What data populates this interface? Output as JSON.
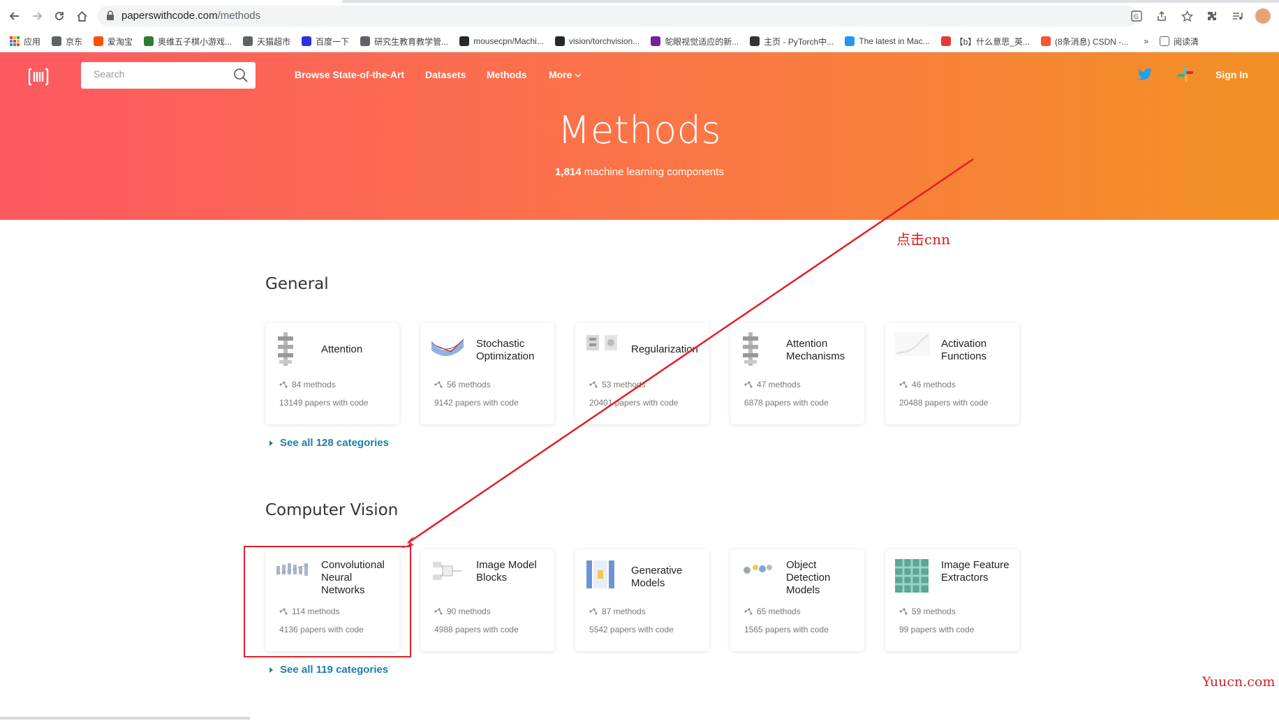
{
  "browser": {
    "url_host": "paperswithcode.com",
    "url_path": "/methods",
    "bookmarks": [
      {
        "label": "应用",
        "color": "#e8453c"
      },
      {
        "label": "京东",
        "color": "#5f6368"
      },
      {
        "label": "爱淘宝",
        "color": "#ff5000"
      },
      {
        "label": "奥维五子棋小游戏...",
        "color": "#2e7d32"
      },
      {
        "label": "天猫超市",
        "color": "#5f6368"
      },
      {
        "label": "百度一下",
        "color": "#2932e1"
      },
      {
        "label": "研究生教育教学管...",
        "color": "#5f6368"
      },
      {
        "label": "mousecpn/Machi...",
        "color": "#24292e"
      },
      {
        "label": "vision/torchvision...",
        "color": "#24292e"
      },
      {
        "label": "鸵眼视觉适应的新...",
        "color": "#7b1fa2"
      },
      {
        "label": "主页 - PyTorch中...",
        "color": "#333333"
      },
      {
        "label": "The latest in Mac...",
        "color": "#2196f3"
      },
      {
        "label": "【b】什么意思_英...",
        "color": "#e53935"
      },
      {
        "label": "(8条消息) CSDN -...",
        "color": "#fc5531"
      }
    ],
    "bookmarks_more": "»",
    "reading_list": "阅读清"
  },
  "header": {
    "search_placeholder": "Search",
    "nav": [
      "Browse State-of-the-Art",
      "Datasets",
      "Methods",
      "More"
    ],
    "sign_in": "Sign In"
  },
  "hero": {
    "title": "Methods",
    "count": "1,814",
    "subtitle": "machine learning components"
  },
  "general": {
    "title": "General",
    "cards": [
      {
        "name": "Attention",
        "methods": "84 methods",
        "papers": "13149 papers with code"
      },
      {
        "name": "Stochastic Optimization",
        "methods": "56 methods",
        "papers": "9142 papers with code"
      },
      {
        "name": "Regularization",
        "methods": "53 methods",
        "papers": "20401 papers with code"
      },
      {
        "name": "Attention Mechanisms",
        "methods": "47 methods",
        "papers": "6878 papers with code"
      },
      {
        "name": "Activation Functions",
        "methods": "46 methods",
        "papers": "20488 papers with code"
      }
    ],
    "see_all": "See all 128 categories"
  },
  "cv": {
    "title": "Computer Vision",
    "cards": [
      {
        "name": "Convolutional Neural Networks",
        "methods": "114 methods",
        "papers": "4136 papers with code"
      },
      {
        "name": "Image Model Blocks",
        "methods": "90 methods",
        "papers": "4988 papers with code"
      },
      {
        "name": "Generative Models",
        "methods": "87 methods",
        "papers": "5542 papers with code"
      },
      {
        "name": "Object Detection Models",
        "methods": "65 methods",
        "papers": "1565 papers with code"
      },
      {
        "name": "Image Feature Extractors",
        "methods": "59 methods",
        "papers": "99 papers with code"
      }
    ],
    "see_all": "See all 119 categories"
  },
  "annotation": {
    "text": "点击cnn",
    "color": "#e21e26"
  },
  "watermark": "Yuucn.com",
  "colors": {
    "hero_start": "#fd5961",
    "hero_end": "#f29124",
    "link": "#1d7fa8"
  }
}
